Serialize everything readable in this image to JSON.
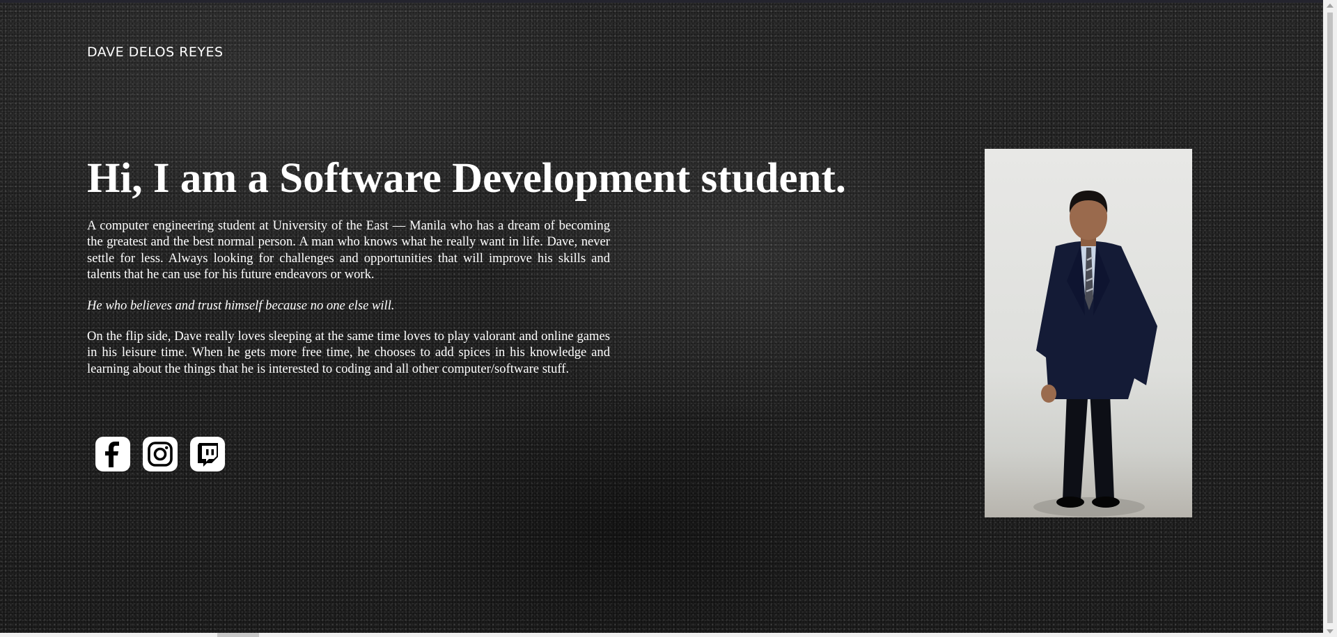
{
  "header": {
    "brand": "DAVE DELOS REYES"
  },
  "hero": {
    "headline": "Hi, I am a Software Development student.",
    "paragraphs": [
      "A computer engineering student at University of the East — Manila who has a dream of becoming the greatest and the best normal person. A man who knows what he really want in life. Dave, never settle for less. Always looking for challenges and opportunities that will improve his skills and talents that he can use for his future endeavors or work.",
      "He who believes and trust himself because no one else will.",
      "On the flip side, Dave really loves sleeping at the same time loves to play valorant and online games in his leisure time. When he gets more free time, he chooses to add spices in his knowledge and learning about the things that he is interested to coding and all other computer/software stuff."
    ]
  },
  "socials": {
    "items": [
      {
        "icon": "facebook-icon"
      },
      {
        "icon": "instagram-icon"
      },
      {
        "icon": "twitch-icon"
      }
    ]
  },
  "portrait": {
    "description_icon": "profile-photo"
  },
  "colors": {
    "text": "#ffffff",
    "background": "#232323",
    "icon": "#000000"
  }
}
